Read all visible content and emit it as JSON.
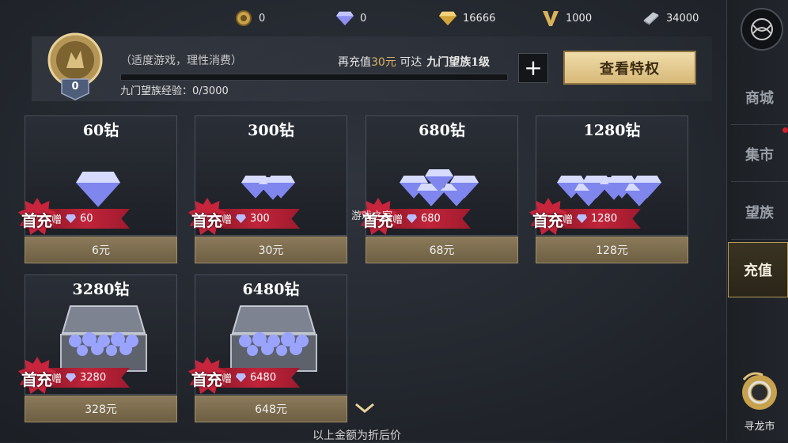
{
  "currencies": [
    {
      "icon": "gold-coin-icon",
      "value": "0"
    },
    {
      "icon": "diamond-icon",
      "value": "0"
    },
    {
      "icon": "gold-diamond-icon",
      "value": "16666"
    },
    {
      "icon": "v-token-icon",
      "value": "1000"
    },
    {
      "icon": "silver-ingot-icon",
      "value": "34000"
    }
  ],
  "header": {
    "badge_level": "0",
    "hint": "（适度游戏，理性消费）",
    "recharge_prefix": "再充值",
    "recharge_amount": "30元",
    "recharge_middle": " 可达",
    "recharge_level": "九门望族1级",
    "exp_label": "九门望族经验：0/3000",
    "progress": 0,
    "plus_label": "+",
    "vip_button": "查看特权"
  },
  "cards": [
    {
      "title": "60钻",
      "gift_prefix": "赠",
      "gift": "60",
      "price": "6元",
      "first_tag": "首充"
    },
    {
      "title": "300钻",
      "gift_prefix": "赠",
      "gift": "300",
      "price": "30元",
      "first_tag": "首充"
    },
    {
      "title": "680钻",
      "gift_prefix": "赠",
      "gift": "680",
      "price": "68元",
      "first_tag": "首充"
    },
    {
      "title": "1280钻",
      "gift_prefix": "赠",
      "gift": "1280",
      "price": "128元",
      "first_tag": "首充"
    },
    {
      "title": "3280钻",
      "gift_prefix": "赠",
      "gift": "3280",
      "price": "328元",
      "first_tag": "首充"
    },
    {
      "title": "6480钻",
      "gift_prefix": "赠",
      "gift": "6480",
      "price": "648元",
      "first_tag": "首充"
    }
  ],
  "sidebar": {
    "items": [
      {
        "label": "商城",
        "active": false
      },
      {
        "label": "集市",
        "active": false,
        "notify": true
      },
      {
        "label": "望族",
        "active": false
      },
      {
        "label": "充值",
        "active": true
      }
    ],
    "bottom_label": "寻龙市"
  },
  "footer_note": "以上金额为折后价",
  "watermark": "游戏之家",
  "colors": {
    "accent_gold": "#d7b978",
    "ribbon_red": "#c0243a",
    "price_bar": "#7d6d4e"
  }
}
